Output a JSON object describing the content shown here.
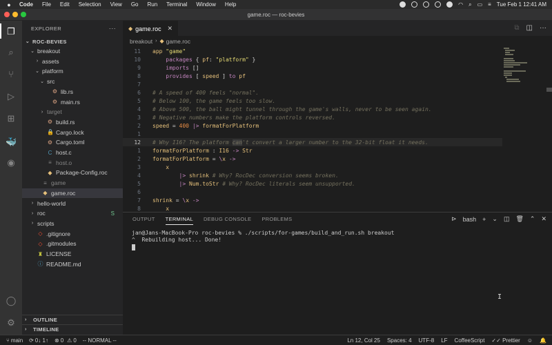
{
  "menubar": {
    "app": "Code",
    "items": [
      "File",
      "Edit",
      "Selection",
      "View",
      "Go",
      "Run",
      "Terminal",
      "Window",
      "Help"
    ],
    "clock": "Tue Feb 1  12:41 AM"
  },
  "window": {
    "title": "game.roc — roc-bevies"
  },
  "sidebar": {
    "header": "EXPLORER",
    "root": "ROC-BEVIES",
    "tree": [
      {
        "label": "breakout",
        "chev": "⌄",
        "indent": 1,
        "icon": "",
        "style": ""
      },
      {
        "label": "assets",
        "chev": "›",
        "indent": 2,
        "icon": "",
        "style": ""
      },
      {
        "label": "platform",
        "chev": "⌄",
        "indent": 2,
        "icon": "",
        "style": ""
      },
      {
        "label": "src",
        "chev": "⌄",
        "indent": 3,
        "icon": "",
        "style": ""
      },
      {
        "label": "lib.rs",
        "chev": "",
        "indent": 4,
        "icon": "⚙",
        "style": ""
      },
      {
        "label": "main.rs",
        "chev": "",
        "indent": 4,
        "icon": "⚙",
        "style": ""
      },
      {
        "label": "target",
        "chev": "›",
        "indent": 3,
        "icon": "",
        "style": "dim"
      },
      {
        "label": "build.rs",
        "chev": "",
        "indent": 3,
        "icon": "⚙",
        "style": ""
      },
      {
        "label": "Cargo.lock",
        "chev": "",
        "indent": 3,
        "icon": "🔒",
        "style": ""
      },
      {
        "label": "Cargo.toml",
        "chev": "",
        "indent": 3,
        "icon": "⚙",
        "style": ""
      },
      {
        "label": "host.c",
        "chev": "",
        "indent": 3,
        "icon": "C",
        "style": ""
      },
      {
        "label": "host.o",
        "chev": "",
        "indent": 3,
        "icon": "≡",
        "style": "dim"
      },
      {
        "label": "Package-Config.roc",
        "chev": "",
        "indent": 3,
        "icon": "◆",
        "style": ""
      },
      {
        "label": "game",
        "chev": "",
        "indent": 2,
        "icon": "≡",
        "style": "dim"
      },
      {
        "label": "game.roc",
        "chev": "",
        "indent": 2,
        "icon": "◆",
        "style": "selected"
      },
      {
        "label": "hello-world",
        "chev": "›",
        "indent": 1,
        "icon": "",
        "style": ""
      },
      {
        "label": "roc",
        "chev": "›",
        "indent": 1,
        "icon": "",
        "style": "",
        "badge": "S"
      },
      {
        "label": "scripts",
        "chev": "›",
        "indent": 1,
        "icon": "",
        "style": ""
      },
      {
        "label": ".gitignore",
        "chev": "",
        "indent": 1,
        "icon": "◇",
        "style": ""
      },
      {
        "label": ".gitmodules",
        "chev": "",
        "indent": 1,
        "icon": "◇",
        "style": ""
      },
      {
        "label": "LICENSE",
        "chev": "",
        "indent": 1,
        "icon": "♜",
        "style": ""
      },
      {
        "label": "README.md",
        "chev": "",
        "indent": 1,
        "icon": "ⓘ",
        "style": ""
      }
    ],
    "sections": [
      "OUTLINE",
      "TIMELINE"
    ]
  },
  "editor": {
    "tab_label": "game.roc",
    "breadcrumb": [
      "breakout",
      "game.roc"
    ],
    "lines": [
      {
        "n": "11",
        "html": "<span class='kw2'>app</span> <span class='str'>\"game\"</span>"
      },
      {
        "n": "10",
        "html": "    <span class='kw'>packages</span> { <span class='id'>pf</span>: <span class='str'>\"platform\"</span> }"
      },
      {
        "n": "9",
        "html": "    <span class='kw'>imports</span> []"
      },
      {
        "n": "8",
        "html": "    <span class='kw'>provides</span> [ <span class='id'>speed</span> ] <span class='kw'>to</span> <span class='id'>pf</span>"
      },
      {
        "n": "7",
        "html": ""
      },
      {
        "n": "6",
        "html": "<span class='cm'># A speed of 400 feels \"normal\".</span>"
      },
      {
        "n": "5",
        "html": "<span class='cm'># Below 100, the game feels too slow.</span>"
      },
      {
        "n": "4",
        "html": "<span class='cm'># Above 500, the ball might tunnel through the game's walls, never to be seen again.</span>"
      },
      {
        "n": "3",
        "html": "<span class='cm'># Negative numbers make the platform controls reversed.</span>"
      },
      {
        "n": "2",
        "html": "<span class='id'>speed</span> = <span class='num'>400</span> <span class='kw'>|&gt;</span> <span class='fn'>formatForPlatform</span>"
      },
      {
        "n": "1",
        "html": ""
      },
      {
        "n": "12",
        "html": "<span class='cm'># Why I16? The platform <span class='hl'>can</span>'t convert a larger number to the 32-bit float it needs.</span>",
        "current": true
      },
      {
        "n": "1",
        "html": "<span class='fn'>formatForPlatform</span> : <span class='ty'>I16</span> <span class='kw'>-&gt;</span> <span class='ty'>Str</span>"
      },
      {
        "n": "2",
        "html": "<span class='fn'>formatForPlatform</span> = <span class='kw'>\\</span><span class='id'>x</span> <span class='kw'>-&gt;</span>"
      },
      {
        "n": "3",
        "html": "    <span class='id'>x</span>"
      },
      {
        "n": "4",
        "html": "        <span class='kw'>|&gt;</span> <span class='fn'>shrink</span> <span class='cm'># Why? RocDec conversion seems broken.</span>"
      },
      {
        "n": "5",
        "html": "        <span class='kw'>|&gt;</span> <span class='fn'>Num.toStr</span> <span class='cm'># Why? RocDec literals seem unsupported.</span>"
      },
      {
        "n": "6",
        "html": ""
      },
      {
        "n": "7",
        "html": "<span class='fn'>shrink</span> = <span class='kw'>\\</span><span class='id'>x</span> <span class='kw'>-&gt;</span>"
      },
      {
        "n": "8",
        "html": "    <span class='id'>x</span>"
      }
    ]
  },
  "panel": {
    "tabs": [
      "OUTPUT",
      "TERMINAL",
      "DEBUG CONSOLE",
      "PROBLEMS"
    ],
    "active_tab": "TERMINAL",
    "shell": "bash",
    "terminal_lines": [
      "jan@Jans-MacBook-Pro roc-bevies % ./scripts/for-games/build_and_run.sh breakout",
      "^  Rebuilding host... Done!"
    ]
  },
  "statusbar": {
    "branch": "main",
    "sync": "0↓ 1↑",
    "errors": "0",
    "warnings": "0",
    "mode": "-- NORMAL --",
    "position": "Ln 12, Col 25",
    "spaces": "Spaces: 4",
    "encoding": "UTF-8",
    "eol": "LF",
    "language": "CoffeeScript",
    "formatter": "Prettier"
  }
}
